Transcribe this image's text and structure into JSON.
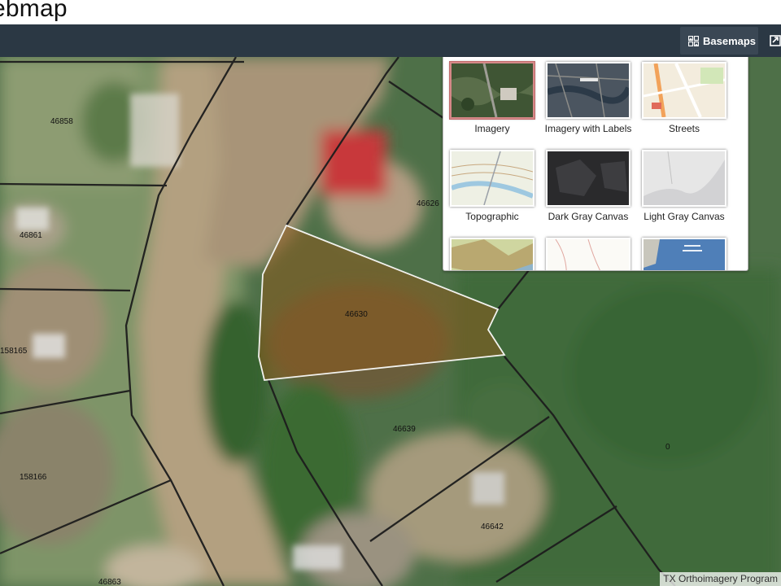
{
  "app": {
    "title": "ebmap"
  },
  "toolbar": {
    "basemaps_label": "Basemaps"
  },
  "basemap_gallery": {
    "items": [
      {
        "label": "Imagery",
        "selected": true
      },
      {
        "label": "Imagery with Labels",
        "selected": false
      },
      {
        "label": "Streets",
        "selected": false
      },
      {
        "label": "Topographic",
        "selected": false
      },
      {
        "label": "Dark Gray Canvas",
        "selected": false
      },
      {
        "label": "Light Gray Canvas",
        "selected": false
      },
      {
        "label": "",
        "selected": false
      },
      {
        "label": "",
        "selected": false
      },
      {
        "label": "",
        "selected": false
      }
    ]
  },
  "map": {
    "parcels": [
      "46858",
      "46861",
      "158165",
      "158166",
      "46863",
      "46626",
      "46630",
      "46639",
      "46642",
      "0"
    ],
    "selected_parcel": "46630",
    "selection_color": "#e8e8e8",
    "attribution": "TX Orthoimagery Program"
  },
  "colors": {
    "toolbar_bg": "#2b3844",
    "selected_outline": "#c06b6b"
  }
}
